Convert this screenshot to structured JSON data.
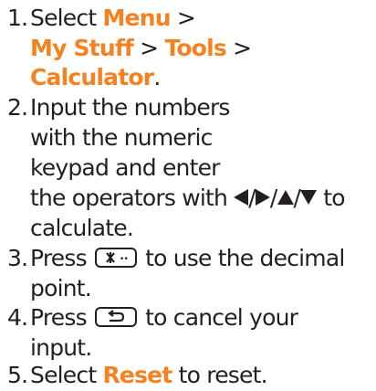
{
  "steps": [
    {
      "number": "1.",
      "text_select": "Select",
      "menu": "Menu",
      "sep_1": ">",
      "my_stuff": "My Stuff",
      "sep_2": ">",
      "tools": "Tools",
      "sep_3": ">",
      "calculator": "Calculator",
      "end": "."
    },
    {
      "number": "2.",
      "line_1": "Input the numbers",
      "line_2": "with the numeric",
      "line_3": "keypad and enter",
      "line_4_start": "the operators with",
      "slash": "/",
      "line_4_end": "to",
      "line_5": "calculate."
    },
    {
      "number": "3.",
      "press": "Press",
      "after_key": "to use the decimal",
      "line_2": "point.",
      "key_icon": "star-key-icon"
    },
    {
      "number": "4.",
      "press": "Press",
      "after_key": "to cancel your",
      "line_2": "input.",
      "key_icon": "back-key-icon"
    },
    {
      "number": "5.",
      "text_select": "Select",
      "reset": "Reset",
      "end": "to reset."
    }
  ],
  "colors": {
    "text": "#231f20",
    "highlight": "#f58220"
  },
  "icons": [
    "left-arrow-icon",
    "right-arrow-icon",
    "up-arrow-icon",
    "down-arrow-icon",
    "star-key-icon",
    "back-key-icon"
  ]
}
